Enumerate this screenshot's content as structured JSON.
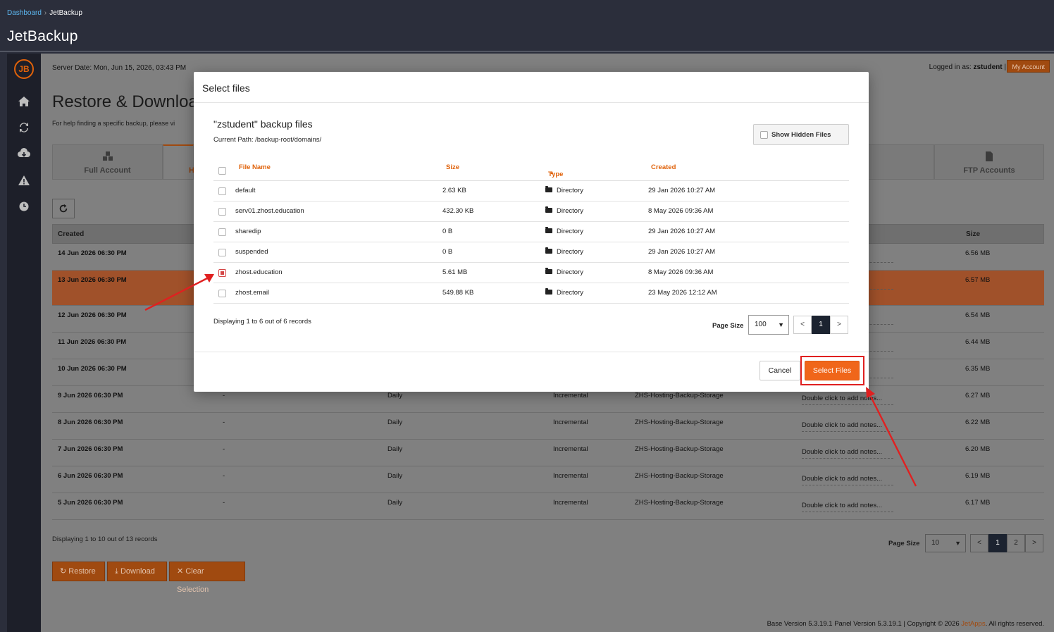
{
  "breadcrumb": {
    "home": "Dashboard",
    "current": "JetBackup"
  },
  "app_title": "JetBackup",
  "server": {
    "date": "Server Date: Mon, Jun 15, 2026, 03:43 PM",
    "logged_prefix": "Logged in as:",
    "user": "zstudent",
    "separator": "|",
    "my_account": "My Account"
  },
  "page": {
    "title": "Restore & Downloa",
    "help": "For help finding a specific backup, please vi"
  },
  "tabs": [
    {
      "label": "Full Account",
      "icon": "cubes-icon"
    },
    {
      "label": "H",
      "icon": ""
    },
    {
      "label": "l Accounts",
      "icon": "envelope-icon"
    },
    {
      "label": "FTP Accounts",
      "icon": "file-icon"
    }
  ],
  "grid": {
    "headers": {
      "created": "Created",
      "size": "Size"
    },
    "rows": [
      {
        "created": "14 Jun 2026 06:30 PM",
        "dash": "",
        "schedule": "",
        "type": "",
        "storage": "",
        "notes": "otes...",
        "size": "6.56 MB"
      },
      {
        "created": "13 Jun 2026 06:30 PM",
        "dash": "",
        "schedule": "",
        "type": "",
        "storage": "",
        "notes": "otes...",
        "size": "6.57 MB"
      },
      {
        "created": "12 Jun 2026 06:30 PM",
        "dash": "",
        "schedule": "",
        "type": "",
        "storage": "",
        "notes": "otes...",
        "size": "6.54 MB"
      },
      {
        "created": "11 Jun 2026 06:30 PM",
        "dash": "",
        "schedule": "",
        "type": "",
        "storage": "",
        "notes": "otes...",
        "size": "6.44 MB"
      },
      {
        "created": "10 Jun 2026 06:30 PM",
        "dash": "",
        "schedule": "",
        "type": "",
        "storage": "",
        "notes": "otes...",
        "size": "6.35 MB"
      },
      {
        "created": "9 Jun 2026 06:30 PM",
        "dash": "-",
        "schedule": "Daily",
        "type": "Incremental",
        "storage": "ZHS-Hosting-Backup-Storage",
        "notes": "Double click to add notes...",
        "size": "6.27 MB"
      },
      {
        "created": "8 Jun 2026 06:30 PM",
        "dash": "-",
        "schedule": "Daily",
        "type": "Incremental",
        "storage": "ZHS-Hosting-Backup-Storage",
        "notes": "Double click to add notes...",
        "size": "6.22 MB"
      },
      {
        "created": "7 Jun 2026 06:30 PM",
        "dash": "-",
        "schedule": "Daily",
        "type": "Incremental",
        "storage": "ZHS-Hosting-Backup-Storage",
        "notes": "Double click to add notes...",
        "size": "6.20 MB"
      },
      {
        "created": "6 Jun 2026 06:30 PM",
        "dash": "-",
        "schedule": "Daily",
        "type": "Incremental",
        "storage": "ZHS-Hosting-Backup-Storage",
        "notes": "Double click to add notes...",
        "size": "6.19 MB"
      },
      {
        "created": "5 Jun 2026 06:30 PM",
        "dash": "-",
        "schedule": "Daily",
        "type": "Incremental",
        "storage": "ZHS-Hosting-Backup-Storage",
        "notes": "Double click to add notes...",
        "size": "6.17 MB"
      }
    ],
    "info": "Displaying 1 to 10 out of 13 records",
    "page_size_label": "Page Size",
    "page_size": "10",
    "prev": "<",
    "pages": [
      "1",
      "2"
    ],
    "next": ">"
  },
  "actions": {
    "restore": "Restore",
    "download": "Download",
    "clear": "Clear Selection"
  },
  "footer": {
    "text": "Base Version 5.3.19.1 Panel Version 5.3.19.1 | Copyright © 2026 ",
    "brand": "JetApps",
    "suffix": ". All rights reserved."
  },
  "modal": {
    "title": "Select files",
    "subtitle": "\"zstudent\" backup files",
    "path": "Current Path: /backup-root/domains/",
    "show_hidden": "Show Hidden Files",
    "headers": {
      "name": "File Name",
      "size": "Size",
      "type": "Type",
      "sort_indicator": "▲",
      "created": "Created"
    },
    "files": [
      {
        "name": "default",
        "size": "2.63 KB",
        "type": "Directory",
        "created": "29 Jan 2026 10:27 AM",
        "checked": false
      },
      {
        "name": "serv01.zhost.education",
        "size": "432.30 KB",
        "type": "Directory",
        "created": "8 May 2026 09:36 AM",
        "checked": false
      },
      {
        "name": "sharedip",
        "size": "0 B",
        "type": "Directory",
        "created": "29 Jan 2026 10:27 AM",
        "checked": false
      },
      {
        "name": "suspended",
        "size": "0 B",
        "type": "Directory",
        "created": "29 Jan 2026 10:27 AM",
        "checked": false
      },
      {
        "name": "zhost.education",
        "size": "5.61 MB",
        "type": "Directory",
        "created": "8 May 2026 09:36 AM",
        "checked": true
      },
      {
        "name": "zhost.email",
        "size": "549.88 KB",
        "type": "Directory",
        "created": "23 May 2026 12:12 AM",
        "checked": false
      }
    ],
    "info": "Displaying 1 to 6 out of 6 records",
    "page_size_label": "Page Size",
    "page_size": "100",
    "prev": "<",
    "page": "1",
    "next": ">",
    "cancel": "Cancel",
    "select": "Select Files"
  },
  "colors": {
    "accent": "#f0661a",
    "highlight": "#e02020",
    "dark": "#2b2e3b"
  }
}
